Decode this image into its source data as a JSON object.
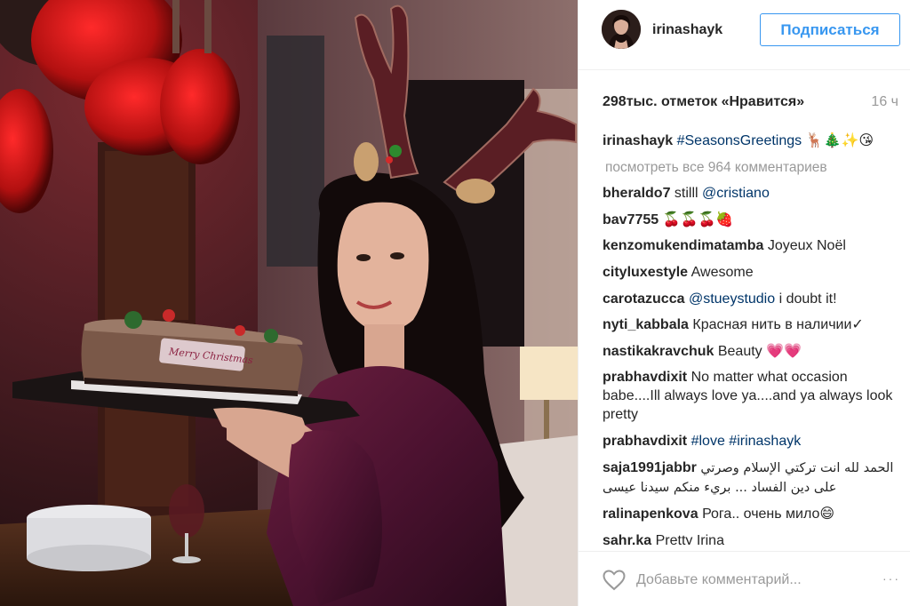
{
  "post": {
    "photo_alt": "",
    "author": {
      "username": "irinashayk"
    },
    "follow_label": "Подписаться",
    "likes_text": "298тыс. отметок «Нравится»",
    "time_ago": "16 ч",
    "caption": {
      "username": "irinashayk",
      "hashtag": "#SeasonsGreetings",
      "emoji": "🦌🎄✨😘"
    },
    "view_all_comments": "посмотреть все 964 комментариев",
    "comments": [
      {
        "username": "bheraldo7",
        "text": "stilll ",
        "mention": "@cristiano"
      },
      {
        "username": "bav7755",
        "text": "🍒🍒🍒🍓"
      },
      {
        "username": "kenzomukendimatamba",
        "text": "Joyeux Noël"
      },
      {
        "username": "cityluxestyle",
        "text": "Awesome"
      },
      {
        "username": "carotazucca",
        "mention": "@stueystudio",
        "text": " i doubt it!"
      },
      {
        "username": "nyti_kabbala",
        "text": "Красная нить в наличии✓"
      },
      {
        "username": "nastikakravchuk",
        "text": "Beauty 💗💗"
      },
      {
        "username": "prabhavdixit",
        "text": "No matter what occasion babe....Ill always love ya....and ya always look pretty"
      },
      {
        "username": "prabhavdixit",
        "tag1": "#love",
        "tag2": "#irinashayk"
      },
      {
        "username": "saja1991jabbr",
        "text": "الحمد لله انت تركتي الإسلام وصرتي على دين الفساد ... بريء منكم سيدنا عيسى"
      },
      {
        "username": "ralinapenkova",
        "text": "Рога.. очень мило😄"
      },
      {
        "username": "sahr.ka",
        "text": "Pretty Irina"
      }
    ],
    "add_comment_placeholder": "Добавьте комментарий...",
    "more_icon": "···"
  },
  "colors": {
    "accent": "#3897f0",
    "username": "#262626",
    "muted": "#999999",
    "link": "#003569"
  }
}
